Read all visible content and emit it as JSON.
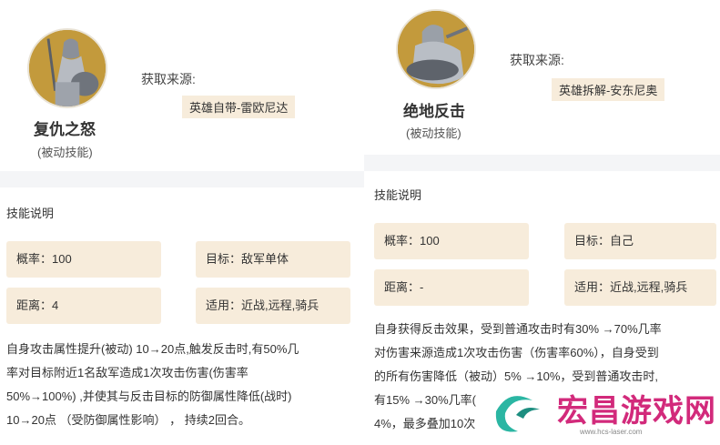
{
  "left": {
    "skill_name": "复仇之怒",
    "skill_type": "(被动技能)",
    "source_label": "获取来源:",
    "source_value": "英雄自带-雷欧尼达",
    "section_title": "技能说明",
    "stats": {
      "probability": "概率：100",
      "target": "目标：敌军单体",
      "distance": "距离：4",
      "applicable": "适用：近战,远程,骑兵"
    },
    "description": [
      "自身攻击属性提升(被动) 10→20点,触发反击时,有50%几",
      "率对目标附近1名敌军造成1次攻击伤害(伤害率",
      "50%→100%) ,并使其与反击目标的防御属性降低(战时)",
      "10→20点 （受防御属性影响） ， 持续2回合。"
    ]
  },
  "right": {
    "skill_name": "绝地反击",
    "skill_type": "(被动技能)",
    "source_label": "获取来源:",
    "source_value": "英雄拆解-安东尼奥",
    "section_title": "技能说明",
    "stats": {
      "probability": "概率：100",
      "target": "目标：自己",
      "distance": "距离：-",
      "applicable": "适用：近战,远程,骑兵"
    },
    "description": [
      "自身获得反击效果，受到普通攻击时有30% →70%几率",
      "对伤害来源造成1次攻击伤害（伤害率60%），自身受到",
      "的所有伤害降低（被动）5% →10%，受到普通攻击时,",
      "有15% →30%几率(",
      "4%，最多叠加10次"
    ]
  },
  "watermark": {
    "text": "宏昌游戏网",
    "url": "www.hcs-laser.com"
  },
  "colors": {
    "tag_bg": "#f7ecdb",
    "separator": "#f4f5f7",
    "watermark": "#d22a7b"
  }
}
